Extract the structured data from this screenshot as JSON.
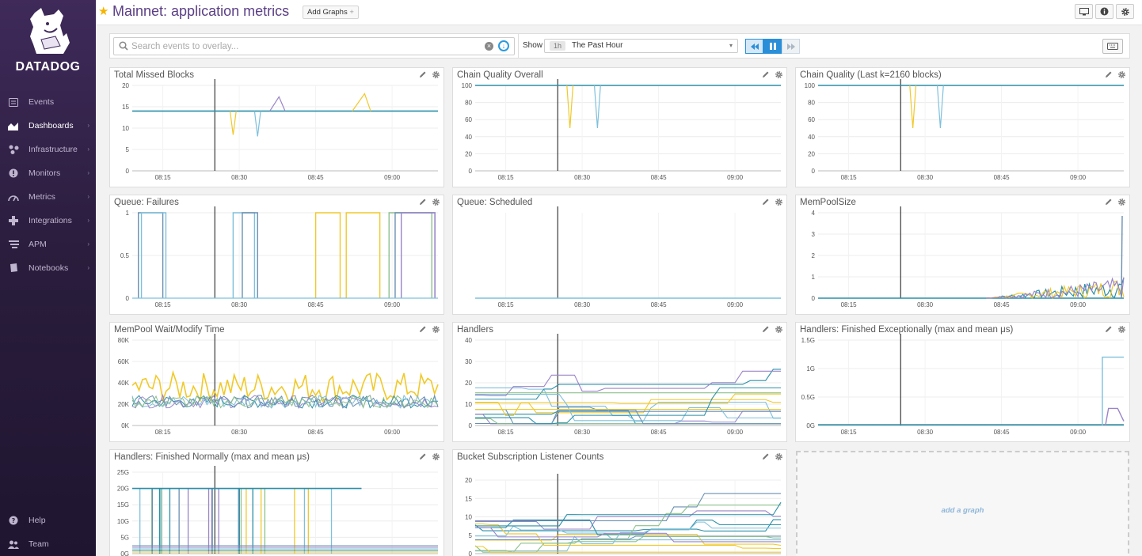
{
  "app": {
    "logo_text": "DATADOG"
  },
  "sidebar": {
    "items": [
      {
        "label": "Events",
        "icon": "events-icon"
      },
      {
        "label": "Dashboards",
        "icon": "dashboards-icon",
        "active": true
      },
      {
        "label": "Infrastructure",
        "icon": "infrastructure-icon"
      },
      {
        "label": "Monitors",
        "icon": "monitors-icon"
      },
      {
        "label": "Metrics",
        "icon": "metrics-icon"
      },
      {
        "label": "Integrations",
        "icon": "integrations-icon"
      },
      {
        "label": "APM",
        "icon": "apm-icon"
      },
      {
        "label": "Notebooks",
        "icon": "notebooks-icon"
      }
    ],
    "bottom": [
      {
        "label": "Help",
        "icon": "help-icon"
      },
      {
        "label": "Team",
        "icon": "team-icon"
      }
    ]
  },
  "header": {
    "title": "Mainnet: application metrics",
    "add_graphs": "Add Graphs",
    "add_graphs_plus": "+"
  },
  "controls": {
    "search_placeholder": "Search events to overlay...",
    "show_label": "Show",
    "timeframe_badge": "1h",
    "timeframe_text": "The Past Hour",
    "caret": "▾"
  },
  "colors": {
    "yellow": "#f0c92a",
    "teal": "#2b8fa8",
    "light_blue": "#7ec0dc",
    "purple": "#9a85c7",
    "gray_blue": "#6a8fb0",
    "green": "#8cc08c",
    "accent": "#2a8fd8",
    "title": "#5b3f86"
  },
  "x_ticks": [
    "08:15",
    "08:30",
    "08:45",
    "09:00"
  ],
  "widgets": [
    {
      "title": "Total Missed Blocks",
      "y_ticks": [
        "20",
        "15",
        "10",
        "5",
        "0"
      ],
      "y_max": 20
    },
    {
      "title": "Chain Quality Overall",
      "y_ticks": [
        "100",
        "80",
        "60",
        "40",
        "20",
        "0"
      ],
      "y_max": 100
    },
    {
      "title": "Chain Quality (Last k=2160 blocks)",
      "y_ticks": [
        "100",
        "80",
        "60",
        "40",
        "20",
        "0"
      ],
      "y_max": 100
    },
    {
      "title": "Queue: Failures",
      "y_ticks": [
        "1",
        "0.5",
        "0"
      ],
      "y_max": 1
    },
    {
      "title": "Queue: Scheduled",
      "y_ticks": [],
      "y_max": 1
    },
    {
      "title": "MemPoolSize",
      "y_ticks": [
        "4",
        "3",
        "2",
        "1",
        "0"
      ],
      "y_max": 4
    },
    {
      "title": "MemPool Wait/Modify Time",
      "y_ticks": [
        "80K",
        "60K",
        "40K",
        "20K",
        "0K"
      ],
      "y_max": 80
    },
    {
      "title": "Handlers",
      "y_ticks": [
        "40",
        "30",
        "20",
        "10",
        "0"
      ],
      "y_max": 40
    },
    {
      "title": "Handlers: Finished Exceptionally (max and mean μs)",
      "y_ticks": [
        "1.5G",
        "1G",
        "0.5G",
        "0G"
      ],
      "y_max": 1.5
    },
    {
      "title": "Handlers: Finished Normally (max and mean μs)",
      "y_ticks": [
        "25G",
        "20G",
        "15G",
        "10G",
        "5G",
        "0G"
      ],
      "y_max": 25
    },
    {
      "title": "Bucket Subscription Listener Counts",
      "y_ticks": [
        "20",
        "15",
        "10",
        "5",
        "0"
      ],
      "y_max": 20
    }
  ],
  "add_graph_label": "add a graph"
}
